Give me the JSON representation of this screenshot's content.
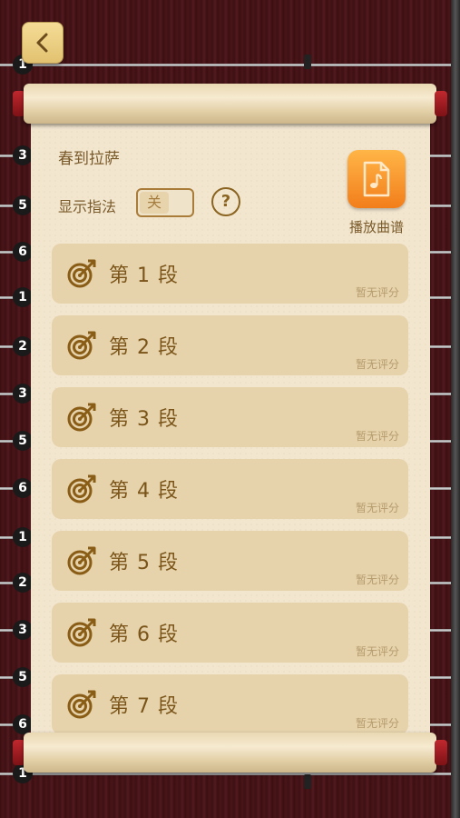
{
  "song": {
    "title": "春到拉萨"
  },
  "fingering": {
    "label": "显示指法",
    "toggle_state": "关"
  },
  "help": {
    "label": "?"
  },
  "play": {
    "label": "播放曲谱"
  },
  "string_labels": [
    "1",
    "3",
    "5",
    "6",
    "1",
    "2",
    "3",
    "5",
    "6",
    "1",
    "2",
    "3",
    "5",
    "6",
    "1"
  ],
  "sections": [
    {
      "name": "第 1 段",
      "score": "暂无评分"
    },
    {
      "name": "第 2 段",
      "score": "暂无评分"
    },
    {
      "name": "第 3 段",
      "score": "暂无评分"
    },
    {
      "name": "第 4 段",
      "score": "暂无评分"
    },
    {
      "name": "第 5 段",
      "score": "暂无评分"
    },
    {
      "name": "第 6 段",
      "score": "暂无评分"
    },
    {
      "name": "第 7 段",
      "score": "暂无评分"
    }
  ],
  "colors": {
    "accent": "#f27e1b",
    "paper": "#f2e6cf",
    "card": "#e6d3ac",
    "text": "#7a5418"
  },
  "icons": {
    "back": "chevron-left-icon",
    "target": "target-arrow-icon",
    "music_file": "music-file-icon"
  }
}
